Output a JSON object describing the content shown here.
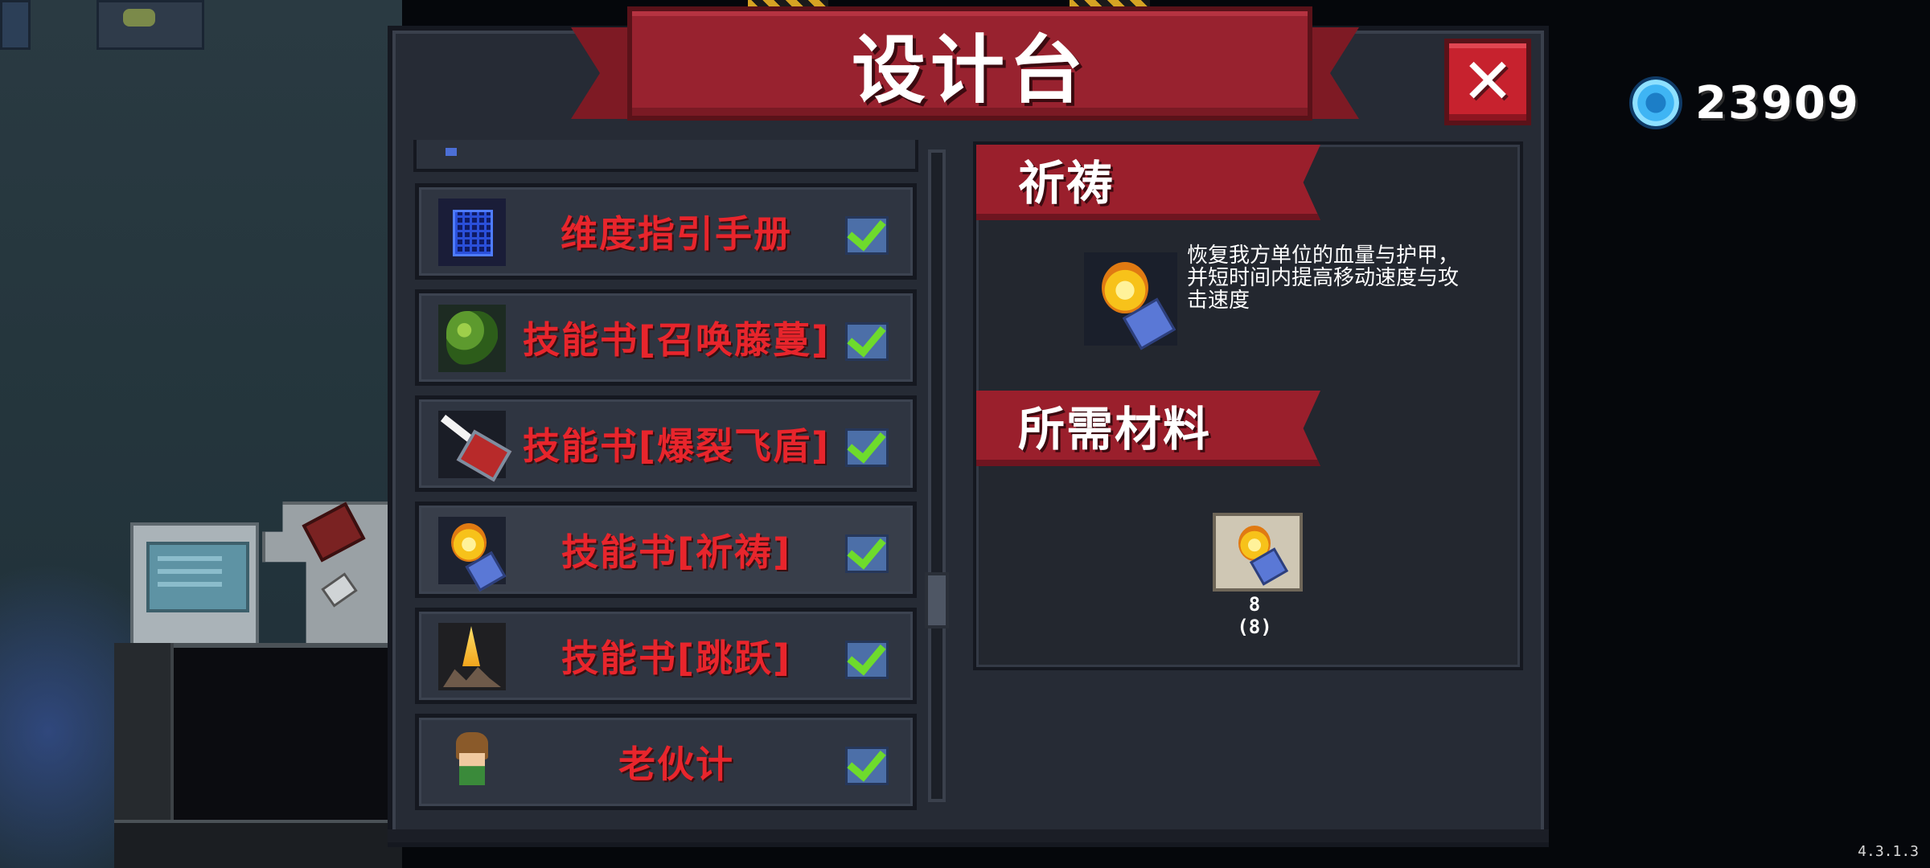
{
  "title": "设计台",
  "close_label": "✕",
  "currency": {
    "icon": "gem-icon",
    "value": "23909"
  },
  "version": "4.3.1.3",
  "list": {
    "items": [
      {
        "name": "维度指引手册",
        "icon": "grid-manual-icon",
        "checked": true
      },
      {
        "name": "技能书[召唤藤蔓]",
        "icon": "vine-icon",
        "checked": true
      },
      {
        "name": "技能书[爆裂飞盾]",
        "icon": "flying-shield-icon",
        "checked": true
      },
      {
        "name": "技能书[祈祷]",
        "icon": "pray-icon",
        "checked": true,
        "selected": true
      },
      {
        "name": "技能书[跳跃]",
        "icon": "jump-icon",
        "checked": true
      },
      {
        "name": "老伙计",
        "icon": "buddy-icon",
        "checked": true
      }
    ]
  },
  "detail": {
    "item_title": "祈祷",
    "description": "恢复我方单位的血量与护甲，并短时间内提高移动速度与攻击速度",
    "materials_title": "所需材料",
    "material": {
      "icon": "pray-scroll-icon",
      "required": "8",
      "owned": "(8)"
    }
  },
  "colors": {
    "accent_red": "#98222f",
    "item_text_red": "#e8252c",
    "check_green": "#6edb2c"
  }
}
